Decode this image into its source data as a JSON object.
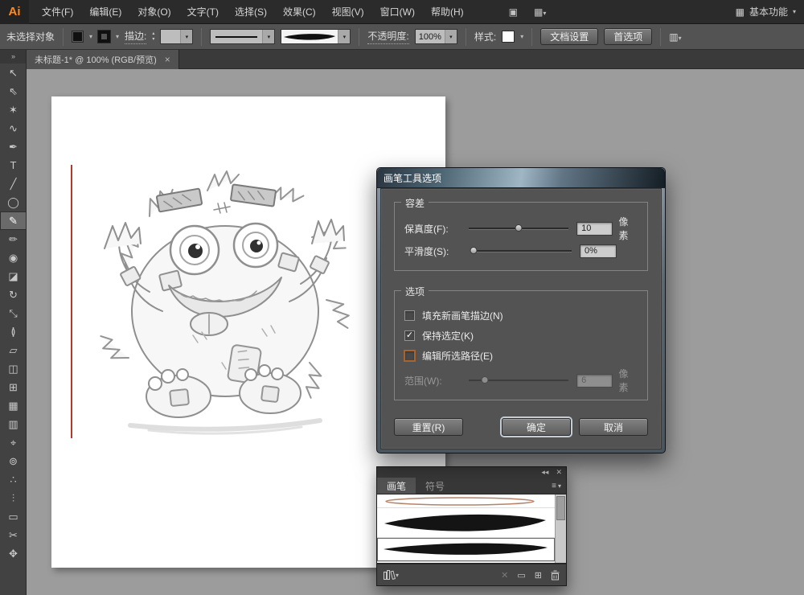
{
  "colors": {
    "menubar_bg": "#2b2b2b",
    "panel_bg": "#535353",
    "canvas_bg": "#9c9c9c",
    "dialog_title_highlight": "#9fb6c5",
    "checkbox_focus_border": "#a8642e",
    "guide_red": "#b23b2e",
    "brush_outline_brown": "#b5826a",
    "logo_orange": "#ff8a1d"
  },
  "app": {
    "logo_text": "Ai"
  },
  "menu_bar": {
    "items": [
      "文件(F)",
      "编辑(E)",
      "对象(O)",
      "文字(T)",
      "选择(S)",
      "效果(C)",
      "视图(V)",
      "窗口(W)",
      "帮助(H)"
    ],
    "workspace_label": "基本功能"
  },
  "icons": {
    "dropdown": "▾",
    "stepper_up": "▴",
    "stepper_down": "▾",
    "collapse_left": "◂◂",
    "close": "✕",
    "panel_menu": "≡",
    "toolbar_collapse": "»",
    "bridge": "▣",
    "arrange_documents": "▦",
    "control_panel_menu": "▥",
    "remove_brush": "✕",
    "stroke_options": "▭",
    "new_brush": "⊞"
  },
  "control_bar": {
    "status_text": "未选择对象",
    "stroke_label": "描边:",
    "stroke_value": "",
    "opacity_label": "不透明度:",
    "opacity_value": "100%",
    "style_label": "样式:",
    "document_setup_button": "文档设置",
    "preferences_button": "首选项"
  },
  "document_tab": {
    "title": "未标题-1* @ 100% (RGB/预览)",
    "close_glyph": "×"
  },
  "tools": [
    {
      "name": "selection-tool",
      "glyph": "↖"
    },
    {
      "name": "direct-selection-tool",
      "glyph": "⇖"
    },
    {
      "name": "magic-wand-tool",
      "glyph": "✶"
    },
    {
      "name": "lasso-tool",
      "glyph": "∿"
    },
    {
      "name": "pen-tool",
      "glyph": "✒"
    },
    {
      "name": "type-tool",
      "glyph": "T"
    },
    {
      "name": "line-segment-tool",
      "glyph": "╱"
    },
    {
      "name": "ellipse-tool",
      "glyph": "◯"
    },
    {
      "name": "paintbrush-tool",
      "glyph": "✎",
      "selected": true
    },
    {
      "name": "pencil-tool",
      "glyph": "✏"
    },
    {
      "name": "blob-brush-tool",
      "glyph": "◉"
    },
    {
      "name": "eraser-tool",
      "glyph": "◪"
    },
    {
      "name": "rotate-tool",
      "glyph": "↻"
    },
    {
      "name": "scale-tool",
      "glyph": "⤡"
    },
    {
      "name": "width-tool",
      "glyph": "≬"
    },
    {
      "name": "free-transform-tool",
      "glyph": "▱"
    },
    {
      "name": "shape-builder-tool",
      "glyph": "◫"
    },
    {
      "name": "perspective-grid-tool",
      "glyph": "⊞"
    },
    {
      "name": "mesh-tool",
      "glyph": "▦"
    },
    {
      "name": "gradient-tool",
      "glyph": "▥"
    },
    {
      "name": "eyedropper-tool",
      "glyph": "⌖"
    },
    {
      "name": "blend-tool",
      "glyph": "⊚"
    },
    {
      "name": "symbol-sprayer-tool",
      "glyph": "∴"
    },
    {
      "name": "column-graph-tool",
      "glyph": "⫶"
    },
    {
      "name": "artboard-tool",
      "glyph": "▭"
    },
    {
      "name": "slice-tool",
      "glyph": "✂"
    },
    {
      "name": "hand-tool",
      "glyph": "✥"
    }
  ],
  "dialog": {
    "title": "画笔工具选项",
    "tolerance_group": {
      "label": "容差",
      "fidelity_label": "保真度(F):",
      "fidelity_value": "10",
      "fidelity_unit": "像素",
      "smoothness_label": "平滑度(S):",
      "smoothness_value": "0%"
    },
    "options_group": {
      "label": "选项",
      "checkboxes": [
        {
          "label": "填充新画笔描边(N)",
          "checked": false,
          "glyph": ""
        },
        {
          "label": "保持选定(K)",
          "checked": true,
          "glyph": "✓"
        },
        {
          "label": "编辑所选路径(E)",
          "checked": false,
          "focus": true,
          "glyph": ""
        }
      ],
      "within_label": "范围(W):",
      "within_value": "6",
      "within_unit": "像素"
    },
    "buttons": {
      "reset": "重置(R)",
      "ok": "确定",
      "cancel": "取消"
    }
  },
  "brushes_panel": {
    "tabs": [
      {
        "label": "画笔",
        "active": true
      },
      {
        "label": "符号",
        "active": false
      }
    ]
  }
}
